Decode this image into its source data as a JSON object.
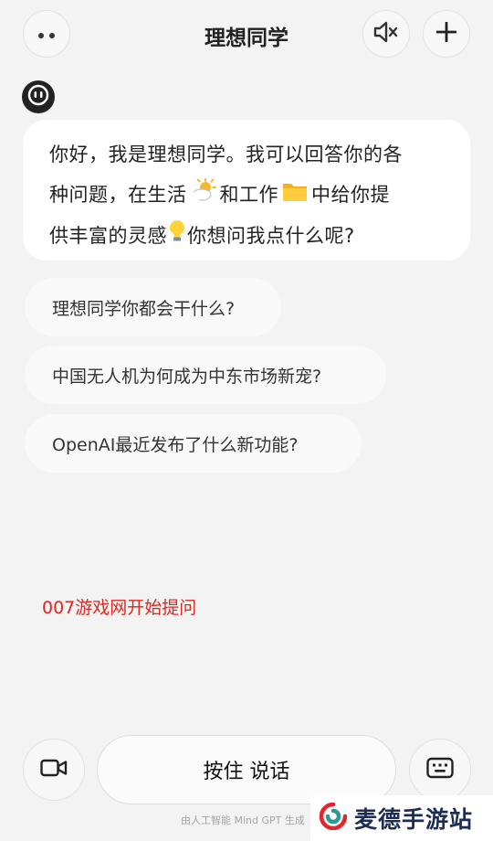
{
  "header": {
    "title": "理想同学",
    "menu_icon": "more-dots-icon",
    "mute_icon": "speaker-muted-icon",
    "add_icon": "plus-icon"
  },
  "assistant": {
    "avatar_icon": "robot-face-icon",
    "greeting_line1": "你好，我是理想同学。我可以回答你的各",
    "greeting_line2a": "种问题，在生活",
    "greeting_line2b": "和工作",
    "greeting_line2c": "中给你提",
    "greeting_line3a": "供丰富的灵感",
    "greeting_line3b": "你想问我点什么呢?",
    "emoji_life": "sun-behind-cloud-icon",
    "emoji_work": "folder-icon",
    "emoji_inspiration": "light-bulb-icon"
  },
  "suggestions": [
    {
      "label": "理想同学你都会干什么?"
    },
    {
      "label": "中国无人机为何成为中东市场新宠?"
    },
    {
      "label": "OpenAI最近发布了什么新功能?"
    }
  ],
  "watermark_text": "007游戏网开始提问",
  "bottom_bar": {
    "video_icon": "video-camera-icon",
    "voice_label": "按住 说话",
    "keyboard_icon": "keyboard-icon",
    "footer_note": "由人工智能 Mind GPT 生成"
  },
  "brand": {
    "logo_icon": "maide-logo-icon",
    "name": "麦德手游站"
  },
  "colors": {
    "background": "#f3f3f3",
    "bubble": "#ffffff",
    "watermark_red": "#e0261e",
    "brand_red": "#e3262b",
    "brand_teal": "#2a9c8e"
  }
}
